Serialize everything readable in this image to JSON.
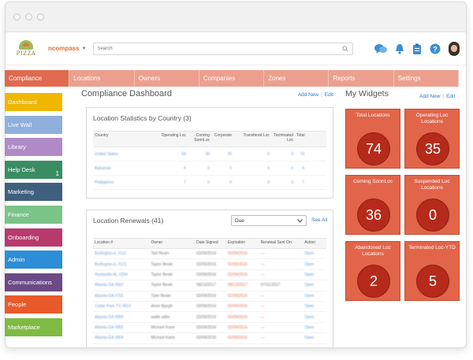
{
  "app": {
    "logo_text": "PIZZA",
    "brand": "ncompass",
    "search_placeholder": "Search"
  },
  "tabs": [
    "Compliance",
    "Locations",
    "Owners",
    "Companies",
    "Zones",
    "Reports",
    "Settings"
  ],
  "sidebar": [
    {
      "label": "Dashboard",
      "color": "#f1b600"
    },
    {
      "label": "Live Wall",
      "color": "#8fb0dd"
    },
    {
      "label": "Library",
      "color": "#b08ac7"
    },
    {
      "label": "Help Desk",
      "color": "#3a8d63",
      "badge": "1"
    },
    {
      "label": "Marketing",
      "color": "#3f5f7e"
    },
    {
      "label": "Finance",
      "color": "#7ac488"
    },
    {
      "label": "Onboarding",
      "color": "#b83a6c"
    },
    {
      "label": "Admin",
      "color": "#2c8ed6"
    },
    {
      "label": "Communications",
      "color": "#6c4a86"
    },
    {
      "label": "People",
      "color": "#e85a2a"
    },
    {
      "label": "Marketplace",
      "color": "#7fba42"
    }
  ],
  "main": {
    "title": "Compliance Dashboard",
    "add_new": "Add New",
    "edit": "Edit",
    "stats": {
      "title": "Location Statistics by Country (3)",
      "headers": [
        "Country",
        "Operating Loc",
        "Coming SoonLoc",
        "Corporate",
        "Transfered Loc",
        "Terminated Loc",
        "Total"
      ],
      "rows": [
        [
          "United States",
          "59",
          "39",
          "20",
          "0",
          "0",
          "74"
        ],
        [
          "Bahamas",
          "6",
          "0",
          "0",
          "0",
          "0",
          "6"
        ],
        [
          "Philippines",
          "7",
          "0",
          "0",
          "0",
          "0",
          "7"
        ]
      ]
    },
    "renewals": {
      "title": "Location Renewals (41)",
      "filter": "Due",
      "see_all": "See All",
      "headers": [
        "Location #",
        "Owner",
        "Date Signed",
        "Expiration",
        "Renewal Sent On",
        "Action"
      ],
      "rows": [
        [
          "Burlington-IL #111",
          "Ted Hearn",
          "02/09/2016",
          "02/09/2016",
          "—",
          "Open"
        ],
        [
          "Burlington-IL #121",
          "Taylor Beale",
          "02/09/2016",
          "02/09/2016",
          "—",
          "Open"
        ],
        [
          "Huntsville-AL #204",
          "Taylor Beale",
          "02/09/2016",
          "02/09/2016",
          "—",
          "Open"
        ],
        [
          "Atlanta-GA #507",
          "Taylor Beale",
          "08/13/2017",
          "08/13/2017",
          "07/31/2017",
          "Open"
        ],
        [
          "Atlanta-GA #701",
          "Tyler Beale",
          "02/09/2016",
          "02/09/2016",
          "—",
          "Open"
        ],
        [
          "Cedar Park-TX #810",
          "Anne Bjorgh",
          "02/09/2016",
          "02/09/2016",
          "—",
          "Open"
        ],
        [
          "Atlanta-GA #800",
          "sadie adler",
          "02/09/2016",
          "02/09/2016",
          "—",
          "Open"
        ],
        [
          "Atlanta-GA #802",
          "Michael Kane",
          "02/09/2016",
          "02/09/2016",
          "—",
          "Open"
        ],
        [
          "Atlanta-GA #804",
          "Michael Kane",
          "02/09/2016",
          "02/09/2016",
          "—",
          "Open"
        ]
      ]
    }
  },
  "widgets": {
    "title": "My Widgets",
    "add_new": "Add New",
    "edit": "Edit",
    "tiles": [
      {
        "label": "Total Locations",
        "value": "74"
      },
      {
        "label": "Operating Loc Locations",
        "value": "35"
      },
      {
        "label": "Coming SoonLoc",
        "value": "36"
      },
      {
        "label": "Suspended Loc Locations",
        "value": "0"
      },
      {
        "label": "Abandoned Loc Locations",
        "value": "2"
      },
      {
        "label": "Terminated Loc-YTD",
        "value": "5"
      }
    ]
  },
  "icons": [
    "chat-icon",
    "bell-icon",
    "clipboard-icon",
    "help-icon",
    "avatar"
  ],
  "colors": {
    "accent": "#e06a4f",
    "tab": "#ec9f8e",
    "tile": "#e2654a",
    "tile_circle": "#b52a1a",
    "link": "#2a78c8"
  }
}
